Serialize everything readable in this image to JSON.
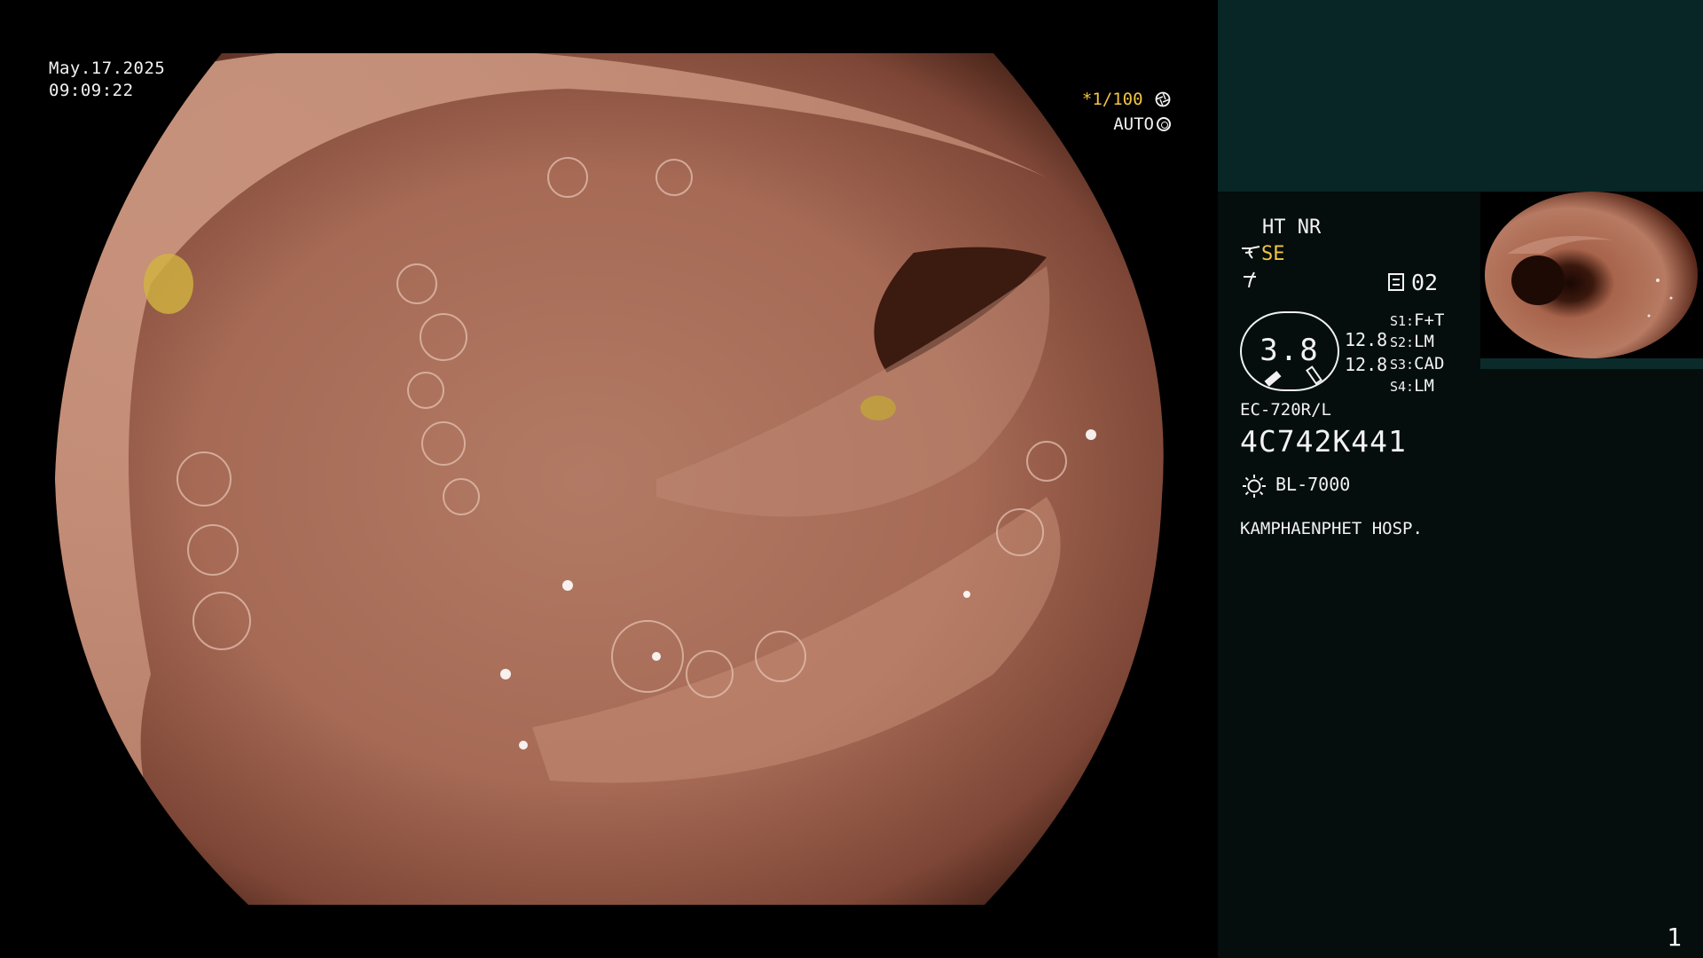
{
  "overlay": {
    "date": "May.17.2025",
    "time": "09:09:22",
    "shutter_prefix": "*",
    "shutter_value": "1/100",
    "exposure_mode": "AUTO"
  },
  "panel": {
    "mode": "HT NR",
    "enhancement": "SE",
    "frame_value": "02",
    "gauge_value": "3.8",
    "num_top": "12.8",
    "num_bottom": "12.8",
    "settings": [
      {
        "key": "S1:",
        "value": "F+T"
      },
      {
        "key": "S2:",
        "value": "LM"
      },
      {
        "key": "S3:",
        "value": "CAD"
      },
      {
        "key": "S4:",
        "value": "LM"
      }
    ],
    "scope_model": "EC-720R/L",
    "serial_number": "4C742K441",
    "light_source": "BL-7000",
    "hospital": "KAMPHAENPHET HOSP.",
    "page_number": "1"
  },
  "icons": {
    "aperture": "aperture-icon",
    "auto_ring": "ring-icon",
    "enhance": "enhance-icon",
    "filter": "filter-icon",
    "frame": "frame-icon",
    "light": "sun-icon"
  },
  "colors": {
    "accent": "#f5c542",
    "panel_top": "#082626",
    "panel_bg": "#050d0d"
  }
}
